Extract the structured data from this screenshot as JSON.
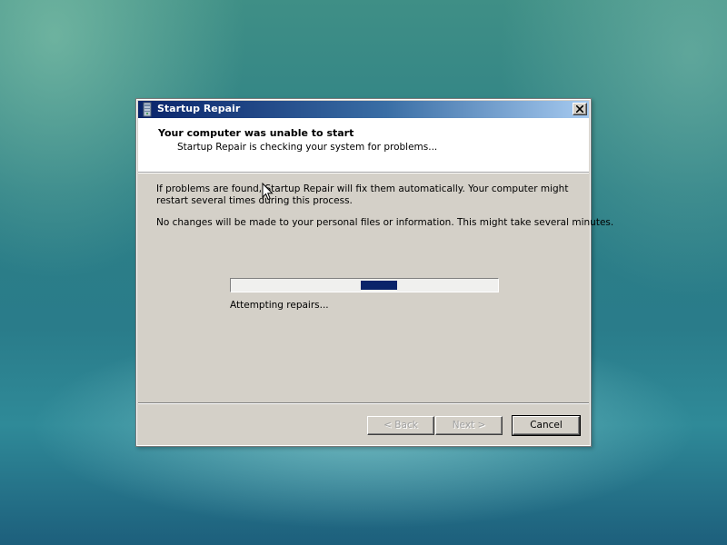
{
  "window": {
    "title": "Startup Repair",
    "close_glyph": "close-icon"
  },
  "header": {
    "title": "Your computer was unable to start",
    "subtitle": "Startup Repair is checking your system for problems..."
  },
  "body": {
    "paragraph1": "If problems are found, Startup Repair will fix them automatically. Your computer might restart several times during this process.",
    "paragraph2": "No changes will be made to your personal files or information. This might take several minutes."
  },
  "progress": {
    "style": "marquee",
    "chunk_start_fraction": 0.485,
    "chunk_width_fraction": 0.135,
    "status": "Attempting repairs..."
  },
  "buttons": {
    "back": "< Back",
    "next": "Next >",
    "cancel": "Cancel"
  },
  "colors": {
    "accent": "#0a246a",
    "dialog_face": "#d4d0c8"
  }
}
